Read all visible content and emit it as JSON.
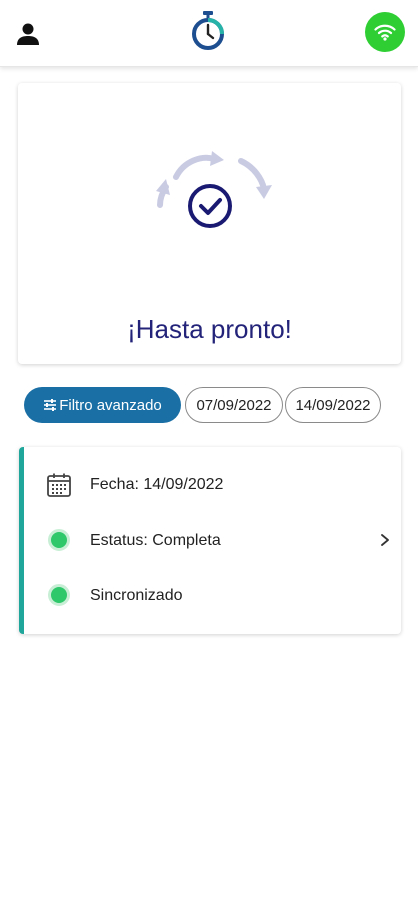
{
  "header": {
    "user_icon": "person-icon",
    "logo_icon": "stopwatch-icon",
    "connection_icon": "wifi-icon",
    "connection_color": "#2fcf34"
  },
  "hero": {
    "message": "¡Hasta pronto!",
    "illustration_icon": "sync-check-icon",
    "message_color": "#23237a"
  },
  "filters": {
    "advanced_label": "Filtro avanzado",
    "date_from": "07/09/2022",
    "date_to": "14/09/2022",
    "accent": "#1a6fa5"
  },
  "record": {
    "date_label": "Fecha: 14/09/2022",
    "status_label": "Estatus: Completa",
    "sync_label": "Sincronizado",
    "status_color": "#2ec76a",
    "border_color": "#20a69a"
  }
}
